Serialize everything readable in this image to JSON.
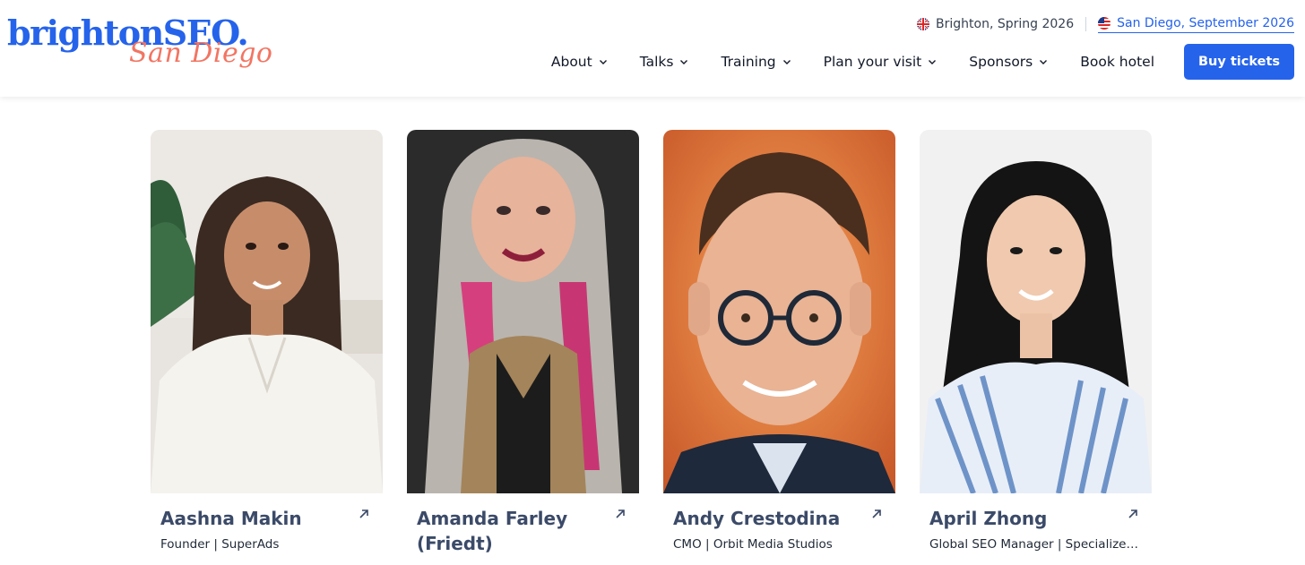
{
  "logo": {
    "main": "brightonSEO.",
    "sub": "San Diego"
  },
  "editions": [
    {
      "label": "Brighton, Spring 2026",
      "flag": "uk-flag-icon"
    },
    {
      "label": "San Diego, September 2026",
      "flag": "us-flag-icon"
    }
  ],
  "nav": {
    "items": [
      {
        "label": "About",
        "has_dropdown": true
      },
      {
        "label": "Talks",
        "has_dropdown": true
      },
      {
        "label": "Training",
        "has_dropdown": true
      },
      {
        "label": "Plan your visit",
        "has_dropdown": true
      },
      {
        "label": "Sponsors",
        "has_dropdown": true
      },
      {
        "label": "Book hotel",
        "has_dropdown": false
      }
    ],
    "cta": "Buy tickets"
  },
  "speakers": [
    {
      "name": "Aashna Makin",
      "role": "Founder | SuperAds"
    },
    {
      "name": "Amanda Farley (Friedt)",
      "role": ""
    },
    {
      "name": "Andy Crestodina",
      "role": "CMO | Orbit Media Studios"
    },
    {
      "name": "April Zhong",
      "role": "Global SEO Manager | Specialized..."
    }
  ],
  "colors": {
    "brand_blue": "#2563eb",
    "brand_coral": "#f27562",
    "name_text": "#3b4a68"
  }
}
